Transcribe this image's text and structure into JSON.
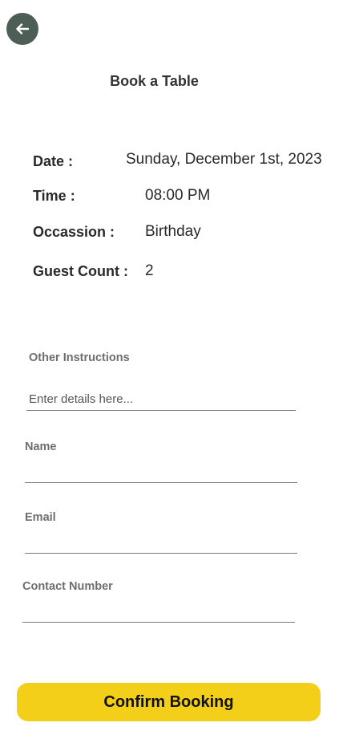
{
  "header": {
    "back_icon": "arrow-left-icon",
    "title": "Book a Table"
  },
  "booking_details": {
    "date_label": "Date :",
    "date_value": "Sunday, December 1st, 2023",
    "time_label": "Time :",
    "time_value": "08:00 PM",
    "occasion_label": "Occassion :",
    "occasion_value": "Birthday",
    "guest_count_label": "Guest Count :",
    "guest_count_value": "2"
  },
  "form": {
    "instructions_label": "Other Instructions",
    "instructions_placeholder": "Enter details here...",
    "instructions_value": "",
    "name_label": "Name",
    "name_value": "",
    "email_label": "Email",
    "email_value": "",
    "contact_label": "Contact Number",
    "contact_value": ""
  },
  "actions": {
    "confirm_label": "Confirm Booking"
  },
  "colors": {
    "back_button_bg": "#4d5e57",
    "confirm_button_bg": "#f4cf1a"
  }
}
